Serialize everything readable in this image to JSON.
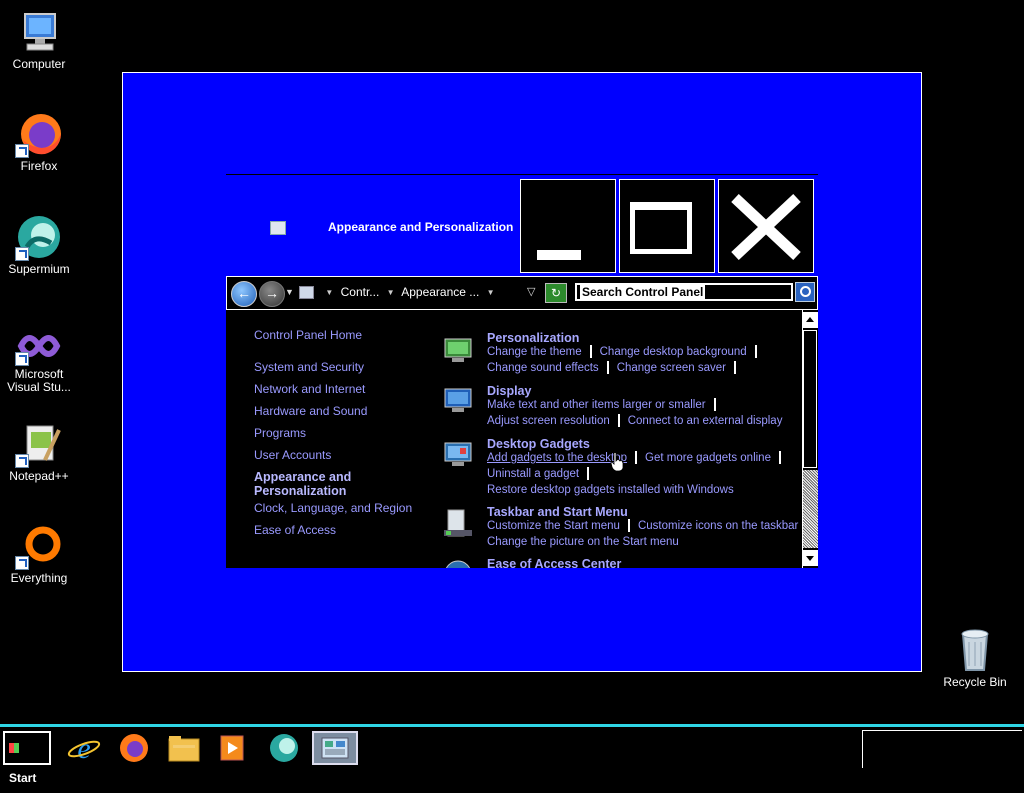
{
  "desktop": {
    "icons": [
      {
        "label": "Computer"
      },
      {
        "label": "Firefox"
      },
      {
        "label": "Supermium"
      },
      {
        "label": "Microsoft Visual Stu..."
      },
      {
        "label": "Notepad++"
      },
      {
        "label": "Everything"
      },
      {
        "label": "Recycle Bin"
      }
    ]
  },
  "window": {
    "title": "Appearance and Personalization"
  },
  "address_bar": {
    "crumbs": [
      "Contr...",
      "Appearance ..."
    ],
    "search_placeholder": "Search Control Panel"
  },
  "left_nav": {
    "items": [
      "Control Panel Home",
      "System and Security",
      "Network and Internet",
      "Hardware and Sound",
      "Programs",
      "User Accounts",
      "Appearance and Personalization",
      "Clock, Language, and Region",
      "Ease of Access"
    ],
    "current_line1": "Appearance and",
    "current_line2": "Personalization"
  },
  "categories": [
    {
      "title": "Personalization",
      "links": [
        [
          "Change the theme",
          "Change desktop background"
        ],
        [
          "Change sound effects",
          "Change screen saver"
        ]
      ]
    },
    {
      "title": "Display",
      "links": [
        [
          "Make text and other items larger or smaller"
        ],
        [
          "Adjust screen resolution",
          "Connect to an external display"
        ]
      ]
    },
    {
      "title": "Desktop Gadgets",
      "links": [
        [
          "Add gadgets to the desktop",
          "Get more gadgets online"
        ],
        [
          "Uninstall a gadget"
        ],
        [
          "Restore desktop gadgets installed with Windows"
        ]
      ]
    },
    {
      "title": "Taskbar and Start Menu",
      "links": [
        [
          "Customize the Start menu",
          "Customize icons on the taskbar"
        ],
        [
          "Change the picture on the Start menu"
        ]
      ]
    },
    {
      "title": "Ease of Access Center",
      "links": []
    }
  ],
  "taskbar": {
    "start_label": "Start",
    "items": [
      "internet-explorer",
      "firefox",
      "file-explorer",
      "media-player",
      "supermium",
      "control-panel"
    ]
  },
  "colors": {
    "desktop_bg": "#000000",
    "window_bg": "#0000ff",
    "link": "#9a9aff",
    "taskbar_border": "#2fd6e6"
  }
}
